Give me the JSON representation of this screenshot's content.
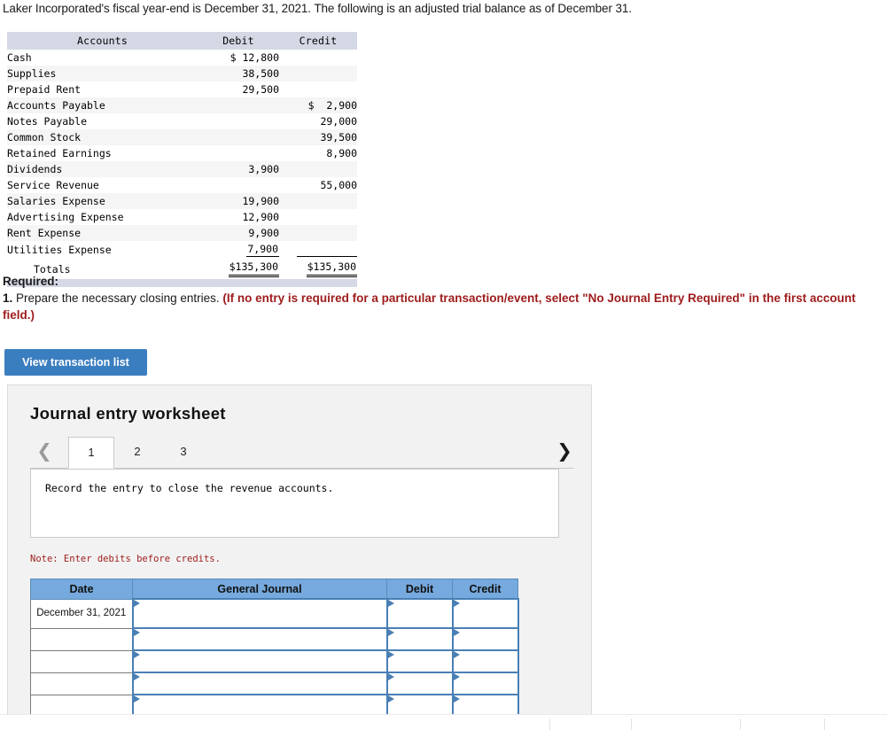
{
  "intro": "Laker Incorporated's fiscal year-end is December 31, 2021. The following is an adjusted trial balance as of December 31.",
  "trial_balance": {
    "headers": {
      "accounts": "Accounts",
      "debit": "Debit",
      "credit": "Credit"
    },
    "rows": [
      {
        "account": "Cash",
        "debit": "$ 12,800",
        "credit": ""
      },
      {
        "account": "Supplies",
        "debit": "38,500",
        "credit": ""
      },
      {
        "account": "Prepaid Rent",
        "debit": "29,500",
        "credit": ""
      },
      {
        "account": "Accounts Payable",
        "debit": "",
        "credit": "$  2,900"
      },
      {
        "account": "Notes Payable",
        "debit": "",
        "credit": "29,000"
      },
      {
        "account": "Common Stock",
        "debit": "",
        "credit": "39,500"
      },
      {
        "account": "Retained Earnings",
        "debit": "",
        "credit": "8,900"
      },
      {
        "account": "Dividends",
        "debit": "3,900",
        "credit": ""
      },
      {
        "account": "Service Revenue",
        "debit": "",
        "credit": "55,000"
      },
      {
        "account": "Salaries Expense",
        "debit": "19,900",
        "credit": ""
      },
      {
        "account": "Advertising Expense",
        "debit": "12,900",
        "credit": ""
      },
      {
        "account": "Rent Expense",
        "debit": "9,900",
        "credit": ""
      },
      {
        "account": "Utilities Expense",
        "debit": "7,900",
        "credit": ""
      }
    ],
    "totals": {
      "label": "Totals",
      "debit": "$135,300",
      "credit": "$135,300"
    }
  },
  "required": {
    "heading": "Required:",
    "item_number": "1.",
    "item_text": " Prepare the necessary closing entries. ",
    "item_red": "(If no entry is required for a particular transaction/event, select \"No Journal Entry Required\" in the first account field.)"
  },
  "buttons": {
    "view_transaction_list": "View transaction list"
  },
  "worksheet": {
    "title": "Journal entry worksheet",
    "tabs": [
      {
        "label": "1",
        "active": true
      },
      {
        "label": "2",
        "active": false
      },
      {
        "label": "3",
        "active": false
      }
    ],
    "prev_icon": "chevron-left",
    "next_icon": "chevron-right",
    "prev_glyph": "❮",
    "next_glyph": "❯",
    "instruction": "Record the entry to close the revenue accounts.",
    "note": "Note: Enter debits before credits.",
    "journal": {
      "headers": {
        "date": "Date",
        "general_journal": "General Journal",
        "debit": "Debit",
        "credit": "Credit"
      },
      "rows": [
        {
          "date": "December 31, 2021",
          "general_journal": "",
          "debit": "",
          "credit": ""
        },
        {
          "date": "",
          "general_journal": "",
          "debit": "",
          "credit": ""
        },
        {
          "date": "",
          "general_journal": "",
          "debit": "",
          "credit": ""
        },
        {
          "date": "",
          "general_journal": "",
          "debit": "",
          "credit": ""
        },
        {
          "date": "",
          "general_journal": "",
          "debit": "",
          "credit": ""
        }
      ]
    }
  },
  "colors": {
    "button_blue": "#3b7ebf",
    "table_header_blue": "#76a9dd",
    "cell_border_blue": "#4a7fb5",
    "tb_header_band": "#d5d9e6",
    "red_note": "#9e1b1b",
    "panel_bg": "#f2f2f2"
  }
}
